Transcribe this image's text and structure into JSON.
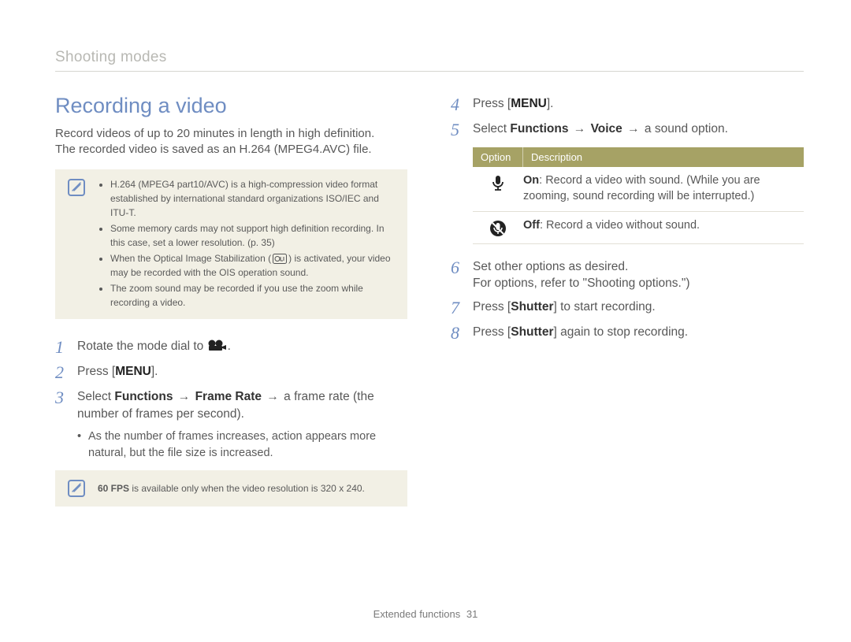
{
  "breadcrumb": "Shooting modes",
  "heading": "Recording a video",
  "intro_line1": "Record videos of up to 20 minutes in length in high definition.",
  "intro_line2": "The recorded video is saved as an H.264 (MPEG4.AVC) file.",
  "notes": {
    "b1a": "H.264 (MPEG4 part10/AVC) is a high-compression video format established by international standard organizations ISO/IEC and ITU-T.",
    "b2a": "Some memory cards may not support high definition recording. In this case, set a lower resolution. (p. 35)",
    "b3a": "When the Optical Image Stabilization (",
    "b3b": ") is activated, your video may be recorded with the OIS operation sound.",
    "b4a": "The zoom sound may be recorded if you use the zoom while recording a video."
  },
  "steps": {
    "s1": {
      "num": "1",
      "pre": "Rotate the mode dial to ",
      "post": "."
    },
    "s2": {
      "num": "2",
      "pre": "Press [",
      "menu": "MENU",
      "post": "]."
    },
    "s3": {
      "num": "3",
      "p0": "Select ",
      "b1": "Functions",
      "arr1": " → ",
      "b2": "Frame Rate",
      "arr2": " → ",
      "p1": "a frame rate (the number of frames per second).",
      "sub": "As the number of frames increases, action appears more natural, but the file size is increased."
    },
    "s4": {
      "num": "4",
      "pre": "Press [",
      "menu": "MENU",
      "post": "]."
    },
    "s5": {
      "num": "5",
      "p0": "Select ",
      "b1": "Functions",
      "arr1": " → ",
      "b2": "Voice",
      "arr2": " → ",
      "p1": "a sound option."
    },
    "s6": {
      "num": "6",
      "l1": "Set other options as desired.",
      "l2": "For options, refer to \"Shooting options.\")"
    },
    "s7": {
      "num": "7",
      "pre": "Press [",
      "b": "Shutter",
      "post": "] to start recording."
    },
    "s8": {
      "num": "8",
      "pre": "Press [",
      "b": "Shutter",
      "post": "] again to stop recording."
    }
  },
  "small_note": {
    "b": "60 FPS",
    "rest": " is available only when the video resolution is 320 x 240."
  },
  "option_table": {
    "h1": "Option",
    "h2": "Description",
    "row1": {
      "b": "On",
      "rest": ": Record a video with sound. (While you are zooming, sound recording will be interrupted.)"
    },
    "row2": {
      "b": "Off",
      "rest": ": Record a video without sound."
    }
  },
  "footer": {
    "label": "Extended functions",
    "page": "31"
  }
}
